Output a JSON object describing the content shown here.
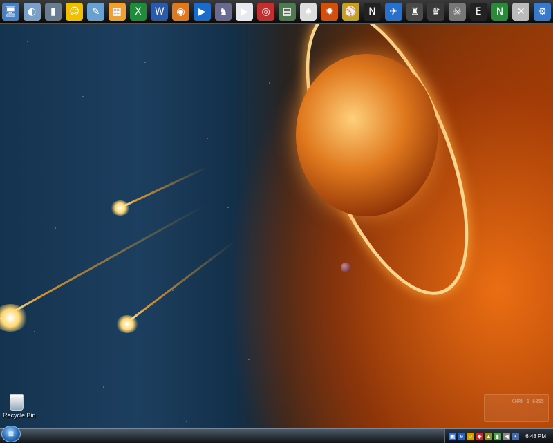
{
  "quick_launch": {
    "icons": [
      {
        "name": "computer-icon",
        "glyph": "🖥",
        "color": "#4a7fc0"
      },
      {
        "name": "vista-tray-icon",
        "glyph": "◐",
        "color": "#7aa0c8"
      },
      {
        "name": "pillar-icon",
        "glyph": "▮",
        "color": "#6a7d90"
      },
      {
        "name": "messenger-icon",
        "glyph": "☺",
        "color": "#f0c000"
      },
      {
        "name": "paint-icon",
        "glyph": "✎",
        "color": "#68a0d0"
      },
      {
        "name": "calendar-icon",
        "glyph": "▦",
        "color": "#f0a030"
      },
      {
        "name": "excel-icon",
        "glyph": "X",
        "color": "#1f8c3c"
      },
      {
        "name": "word-icon",
        "glyph": "W",
        "color": "#2a5aa8"
      },
      {
        "name": "firefox-icon",
        "glyph": "◉",
        "color": "#e07820"
      },
      {
        "name": "media-player-icon",
        "glyph": "▶",
        "color": "#1b6cc8"
      },
      {
        "name": "warcraft-icon",
        "glyph": "♞",
        "color": "#6a6a90"
      },
      {
        "name": "play-icon",
        "glyph": "▶",
        "color": "#e8e8f0"
      },
      {
        "name": "cd-burner-icon",
        "glyph": "◎",
        "color": "#c03030"
      },
      {
        "name": "book-icon",
        "glyph": "▤",
        "color": "#4d7a50"
      },
      {
        "name": "hat-icon",
        "glyph": "♠",
        "color": "#ddd"
      },
      {
        "name": "sun-game-icon",
        "glyph": "✹",
        "color": "#d05010"
      },
      {
        "name": "sports-game-icon",
        "glyph": "⚾",
        "color": "#c8a020"
      },
      {
        "name": "nascar-icon",
        "glyph": "N",
        "color": "#222"
      },
      {
        "name": "flight-simulator-icon",
        "glyph": "✈",
        "color": "#2a70c8"
      },
      {
        "name": "soldier-game-icon",
        "glyph": "♜",
        "color": "#4a4a4a"
      },
      {
        "name": "warhammer-icon",
        "glyph": "♛",
        "color": "#3a3a3a"
      },
      {
        "name": "skull-game-icon",
        "glyph": "☠",
        "color": "#777"
      },
      {
        "name": "e-game-icon",
        "glyph": "E",
        "color": "#222"
      },
      {
        "name": "n64-emulator-icon",
        "glyph": "N",
        "color": "#2a8a3a"
      },
      {
        "name": "xbox-icon",
        "glyph": "✕",
        "color": "#bbb"
      },
      {
        "name": "settings-gear-icon",
        "glyph": "⚙",
        "color": "#3a78c8"
      }
    ]
  },
  "desktop": {
    "recycle_bin_label": "Recycle Bin",
    "watermark_text": "CHRN 1 6055"
  },
  "taskbar": {
    "start_glyph": "⊞",
    "tray_icons": [
      {
        "name": "network-tray-icon",
        "glyph": "▣",
        "color": "#3a70c0"
      },
      {
        "name": "ie-tray-icon",
        "glyph": "e",
        "color": "#2a60b0"
      },
      {
        "name": "messenger-tray-icon",
        "glyph": "☺",
        "color": "#d0a000"
      },
      {
        "name": "antivirus-tray-icon",
        "glyph": "◆",
        "color": "#c03030"
      },
      {
        "name": "security-tray-icon",
        "glyph": "▲",
        "color": "#909030"
      },
      {
        "name": "battery-tray-icon",
        "glyph": "▮",
        "color": "#50a050"
      },
      {
        "name": "volume-tray-icon",
        "glyph": "◀",
        "color": "#888"
      },
      {
        "name": "display-tray-icon",
        "glyph": "▪",
        "color": "#4a6aa0"
      }
    ],
    "clock": "6:48 PM"
  }
}
